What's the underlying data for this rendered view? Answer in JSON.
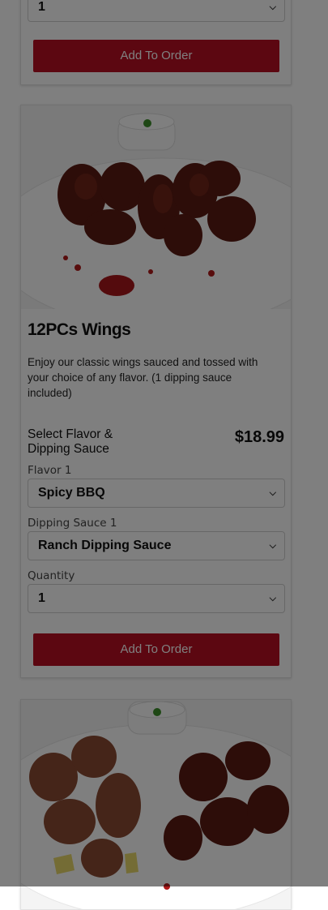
{
  "top_card": {
    "quantity_value": "1",
    "add_button_label": "Add To Order"
  },
  "item": {
    "title": "12PCs Wings",
    "description": "Enjoy our classic wings sauced and tossed with your choice of any flavor. (1 dipping sauce included)",
    "options_label": "Select Flavor & Dipping Sauce",
    "price": "$18.99",
    "flavor_label": "Flavor 1",
    "flavor_value": "Spicy BBQ",
    "sauce_label": "Dipping Sauce 1",
    "sauce_value": "Ranch Dipping Sauce",
    "quantity_label": "Quantity",
    "quantity_value": "1",
    "add_button_label": "Add To Order"
  },
  "colors": {
    "brand_red": "#b80f22",
    "overlay": "rgba(0,0,0,0.5)"
  },
  "icons": {
    "select_arrow": "chevron-down-icon"
  }
}
